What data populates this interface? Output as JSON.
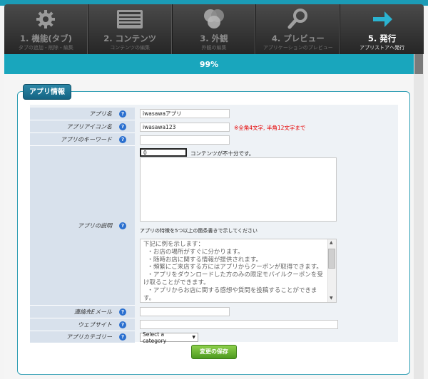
{
  "steps": [
    {
      "label": "1. 機能(タブ)",
      "sub": "タブの追加・削除・編集",
      "icon": "gear-icon"
    },
    {
      "label": "2. コンテンツ",
      "sub": "コンテンツの編集",
      "icon": "document-list-icon"
    },
    {
      "label": "3. 外観",
      "sub": "外観の編集",
      "icon": "color-circles-icon"
    },
    {
      "label": "4. プレビュー",
      "sub": "アプリケーションのプレビュー",
      "icon": "magnifier-icon"
    },
    {
      "label": "5. 発行",
      "sub": "アプリストアへ発行",
      "icon": "arrow-right-icon"
    }
  ],
  "progress": {
    "text": "99%",
    "value": 0.99
  },
  "section": {
    "title": "アプリ情報"
  },
  "fields": {
    "app_name": {
      "label": "アプリ名",
      "value": "iwasawaアプリ"
    },
    "icon_name": {
      "label": "アプリアイコン名",
      "value": "iwasawa123",
      "note": "※全角4文字, 半角12文字まで"
    },
    "keyword": {
      "label": "アプリのキーワード",
      "value": ""
    },
    "description": {
      "label": "アプリの説明",
      "counter": "0",
      "counter_note": "コンテンツが不十分です。",
      "value": "",
      "hint": "アプリの特徴を5つ以上の箇条書きで示してください",
      "sample": "下記に例を示します：\n  ・お店の場所がすぐに分かります。\n  ・随時お店に関する情報が提供されます。\n  ・頻繁にご来店する方にはアプリからクーポンが取得できます。\n  ・アプリをダウンロードした方のみの限定モバイルクーポンを受け取ることができます。\n  ・アプリからお店に関する感想や質問を投稿することができます。"
    },
    "email": {
      "label": "連絡先Eメール",
      "value": ""
    },
    "website": {
      "label": "ウェブサイト",
      "value": ""
    },
    "category": {
      "label": "アプリカテゴリー",
      "value": "Select a category"
    }
  },
  "save_label": "変更の保存",
  "colors": {
    "accent": "#1b9bb6",
    "note": "#e60000",
    "save": "#5aa82a"
  }
}
